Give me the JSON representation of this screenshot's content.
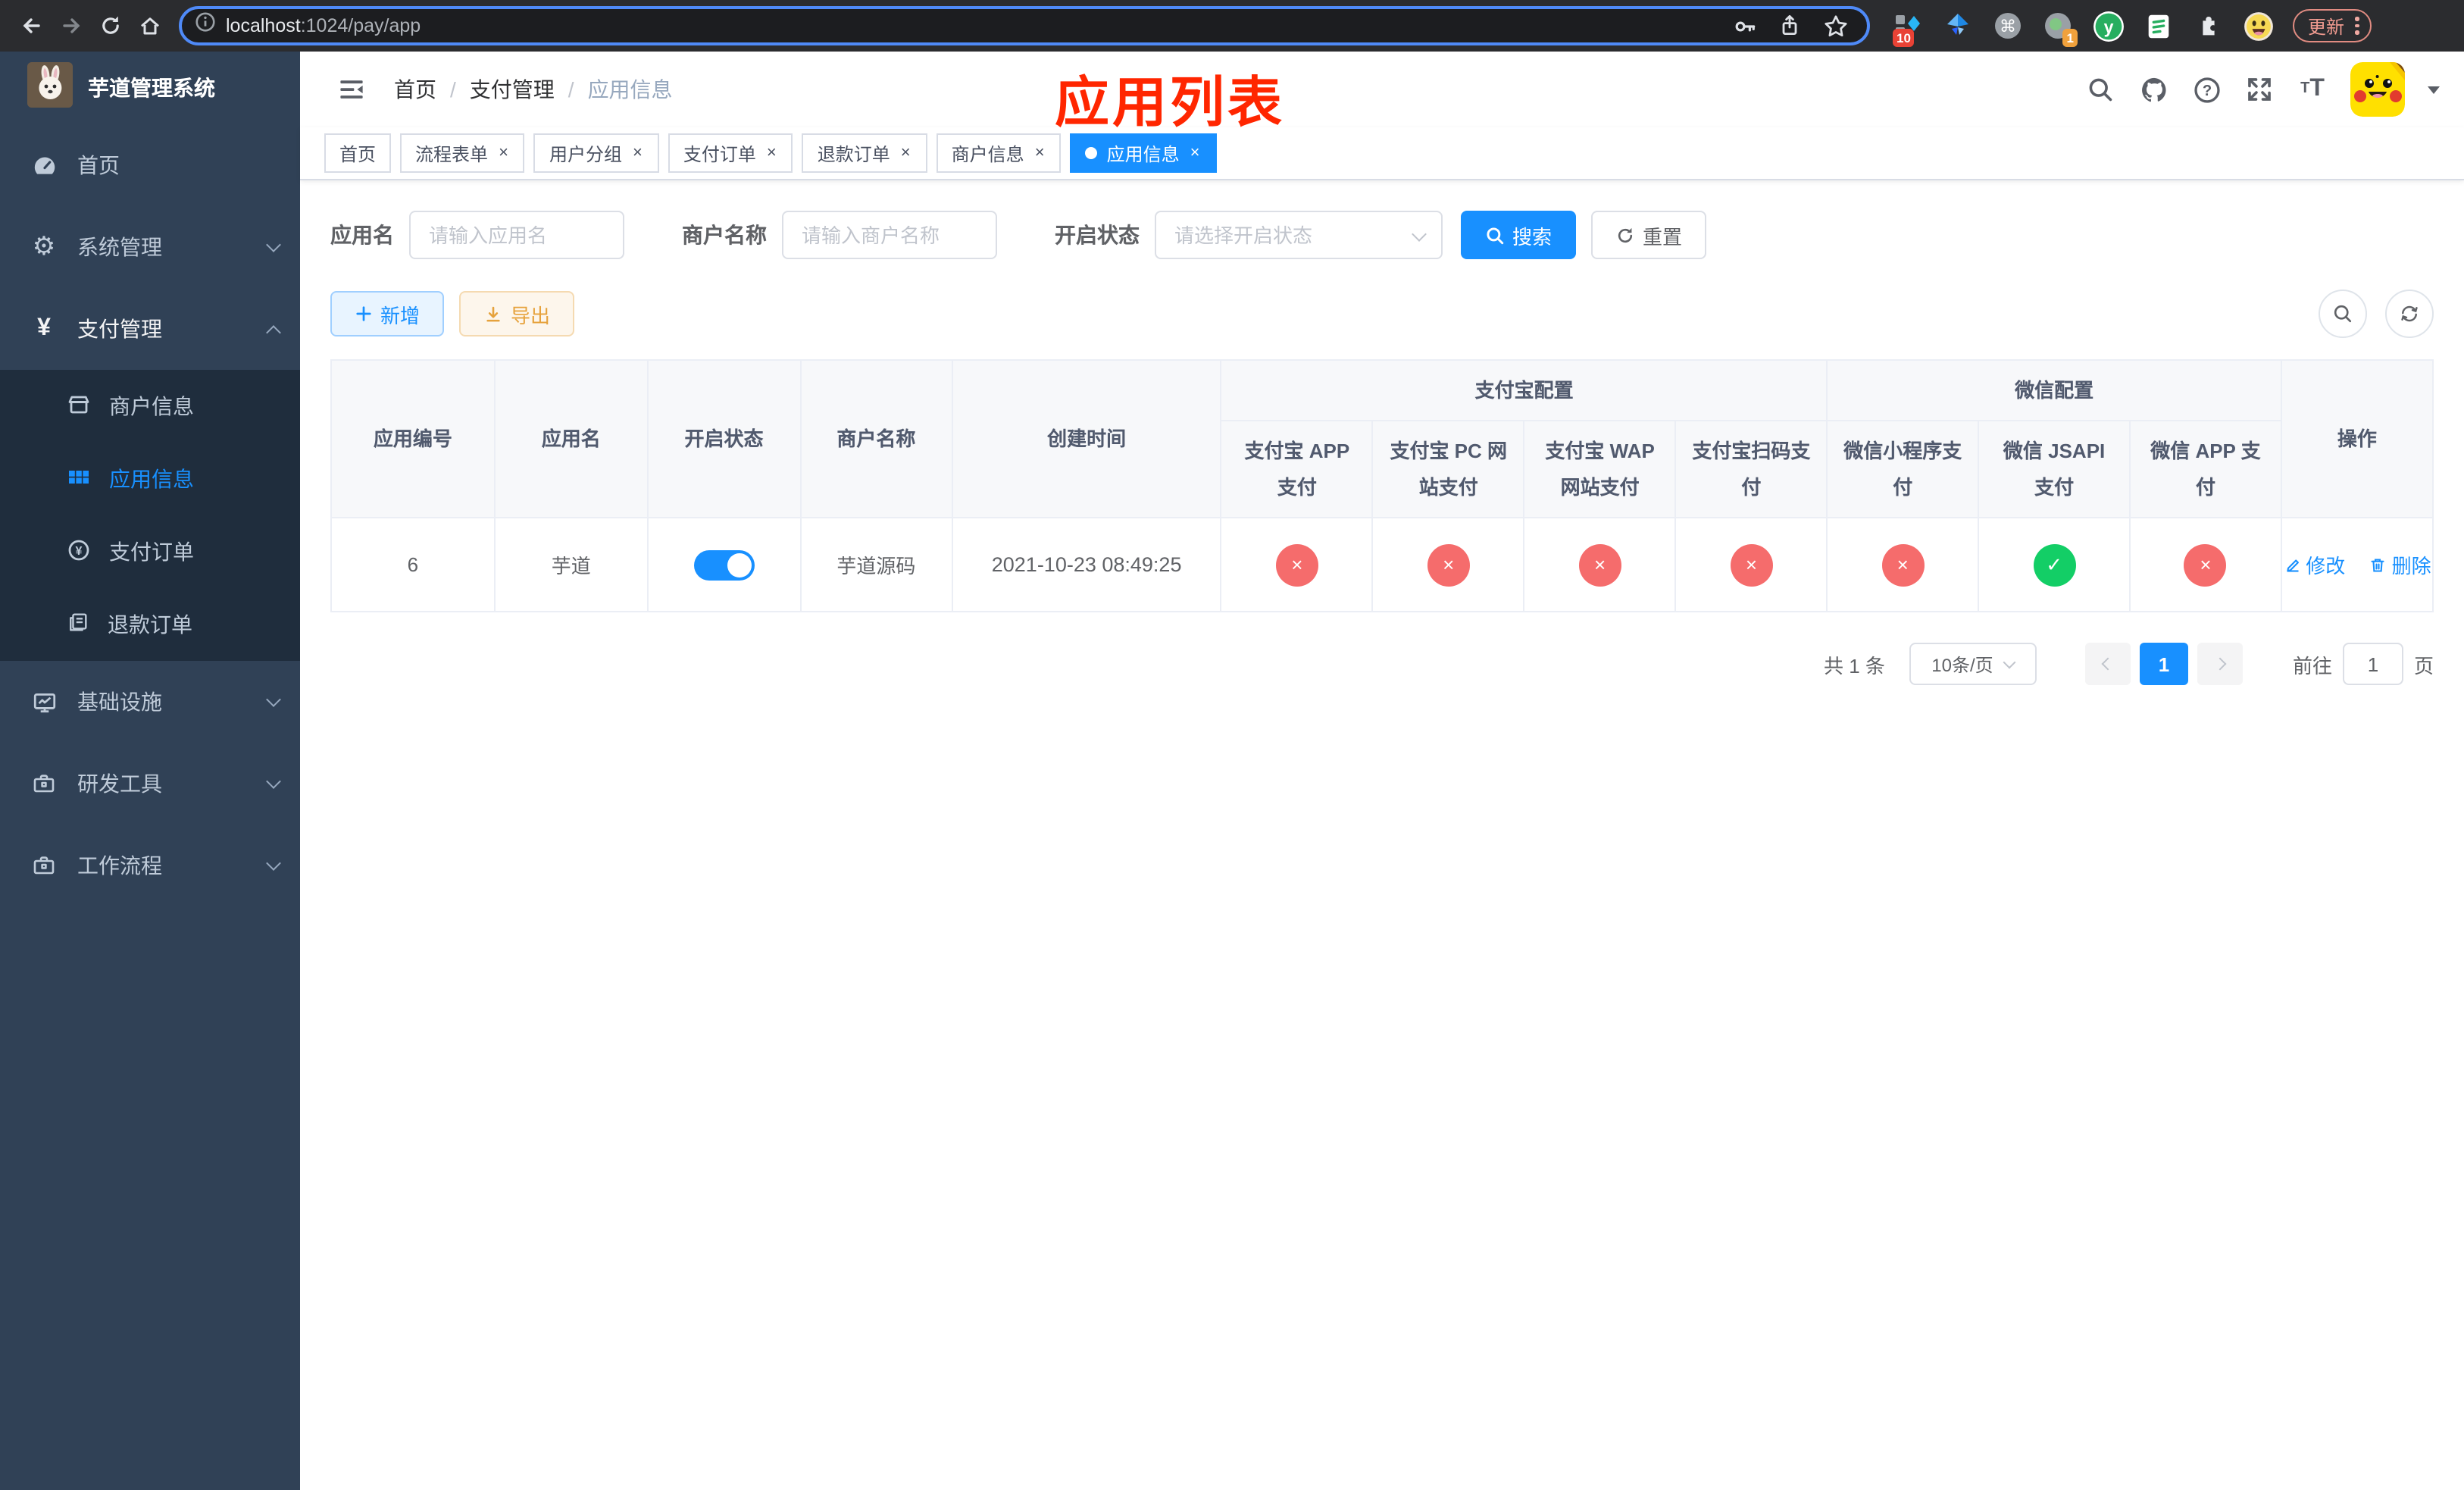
{
  "browser": {
    "url_host": "localhost",
    "url_rest": ":1024/pay/app",
    "ext_badge_blue": "10",
    "ext_badge_gray": "1",
    "update_label": "更新"
  },
  "sidebar": {
    "title": "芋道管理系统",
    "home": "首页",
    "system": "系统管理",
    "payment": "支付管理",
    "submenu": [
      "商户信息",
      "应用信息",
      "支付订单",
      "退款订单"
    ],
    "infra": "基础设施",
    "devtools": "研发工具",
    "workflow": "工作流程"
  },
  "header": {
    "breadcrumb": [
      "首页",
      "支付管理",
      "应用信息"
    ],
    "annotation": "应用列表"
  },
  "tabs": {
    "items": [
      "首页",
      "流程表单",
      "用户分组",
      "支付订单",
      "退款订单",
      "商户信息",
      "应用信息"
    ],
    "active_index": 6
  },
  "filters": {
    "app_name_label": "应用名",
    "app_name_placeholder": "请输入应用名",
    "merchant_label": "商户名称",
    "merchant_placeholder": "请输入商户名称",
    "status_label": "开启状态",
    "status_placeholder": "请选择开启状态",
    "search_label": "搜索",
    "reset_label": "重置"
  },
  "toolbar": {
    "add_label": "新增",
    "export_label": "导出"
  },
  "table": {
    "col_id": "应用编号",
    "col_name": "应用名",
    "col_status": "开启状态",
    "col_merchant": "商户名称",
    "col_created": "创建时间",
    "group_alipay": "支付宝配置",
    "group_wechat": "微信配置",
    "sub_cols": [
      "支付宝 APP 支付",
      "支付宝 PC 网站支付",
      "支付宝 WAP 网站支付",
      "支付宝扫码支付",
      "微信小程序支付",
      "微信 JSAPI 支付",
      "微信 APP 支付"
    ],
    "col_ops": "操作",
    "row": {
      "id": "6",
      "name": "芋道",
      "enabled": true,
      "merchant": "芋道源码",
      "created": "2021-10-23 08:49:25",
      "statuses": [
        "disabled",
        "disabled",
        "disabled",
        "disabled",
        "disabled",
        "enabled",
        "disabled"
      ],
      "icons": [
        "×",
        "×",
        "×",
        "×",
        "×",
        "✓",
        "×"
      ],
      "edit_label": "修改",
      "delete_label": "删除"
    }
  },
  "pagination": {
    "total": "共 1 条",
    "page_size": "10条/页",
    "page": "1",
    "goto_label": "前往",
    "goto_value": "1",
    "unit": "页"
  },
  "colors": {
    "accent": "#1890ff",
    "danger": "#f56c6c",
    "success": "#13ce66",
    "warning": "#e6a23c",
    "sidebar_bg": "#304156",
    "submenu_bg": "#1f2d3d",
    "annotation": "#ff2600"
  }
}
